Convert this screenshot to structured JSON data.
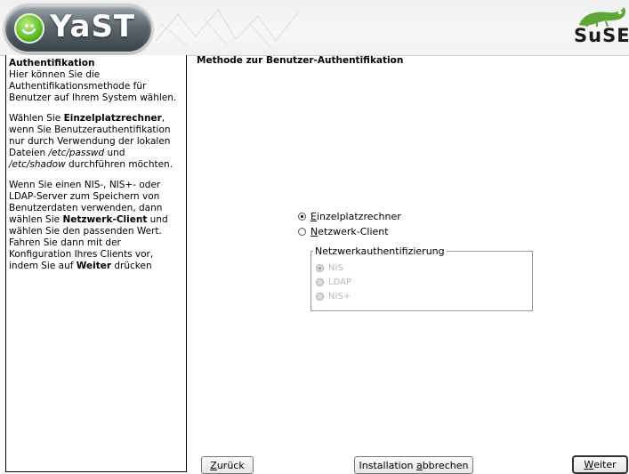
{
  "header": {
    "logo_text": "YaST",
    "brand": "SuSE"
  },
  "help": {
    "title": "Authentifikation",
    "p1": "Hier können Sie die Authentifikationsmethode für Benutzer auf Ihrem System wählen.",
    "p2_a": "Wählen Sie ",
    "p2_b": "Einzelplatzrechner",
    "p2_c": ", wenn Sie Benutzerauthentifikation nur durch Verwendung der lokalen Dateien ",
    "p2_d": "/etc/passwd",
    "p2_e": " und ",
    "p2_f": "/etc/shadow",
    "p2_g": " durchführen möchten.",
    "p3_a": "Wenn Sie einen NIS-, NIS+- oder LDAP-Server zum Speichern von Benutzerdaten verwenden, dann wählen Sie ",
    "p3_b": "Netzwerk-Client",
    "p3_c": " und wählen Sie den passenden Wert. Fahren Sie dann mit der Konfiguration Ihres Clients vor, indem Sie auf ",
    "p3_d": "Weiter",
    "p3_e": " drücken"
  },
  "main": {
    "title": "Methode zur Benutzer-Authentifikation",
    "opt1_first": "E",
    "opt1_rest": "inzelplatzrechner",
    "opt2_first": "N",
    "opt2_rest": "etzwerk-Client",
    "group_title": "Netzwerkauthentifizierung",
    "sub": [
      "NIS",
      "LDAP",
      "NIS+"
    ]
  },
  "buttons": {
    "back_first": "Z",
    "back_rest": "urück",
    "abort_a": "Installation ",
    "abort_u": "a",
    "abort_b": "bbrechen",
    "next_first": "W",
    "next_rest": "eiter"
  }
}
